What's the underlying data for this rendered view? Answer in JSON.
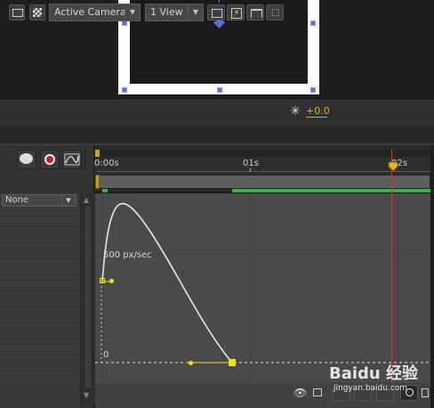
{
  "toolbar": {
    "camera_label": "Active Camera",
    "view_label": "1 View",
    "exposure_label": "+0.0"
  },
  "timeline": {
    "tick_start": "0:00s",
    "tick_mid": "01s",
    "tick_end": "02s"
  },
  "graph_editor": {
    "property_dropdown": "None",
    "speed_label": "500 px/sec",
    "zero_label": "0"
  },
  "watermark": "Baidu 经验 jingyan.baidu.com",
  "colors": {
    "accent_orange": "#e8a33c",
    "work_area_green": "#35b545",
    "cti_red": "#d03030",
    "keyframe_yellow": "#f2e600",
    "handle_blue": "#5a6fd8"
  }
}
